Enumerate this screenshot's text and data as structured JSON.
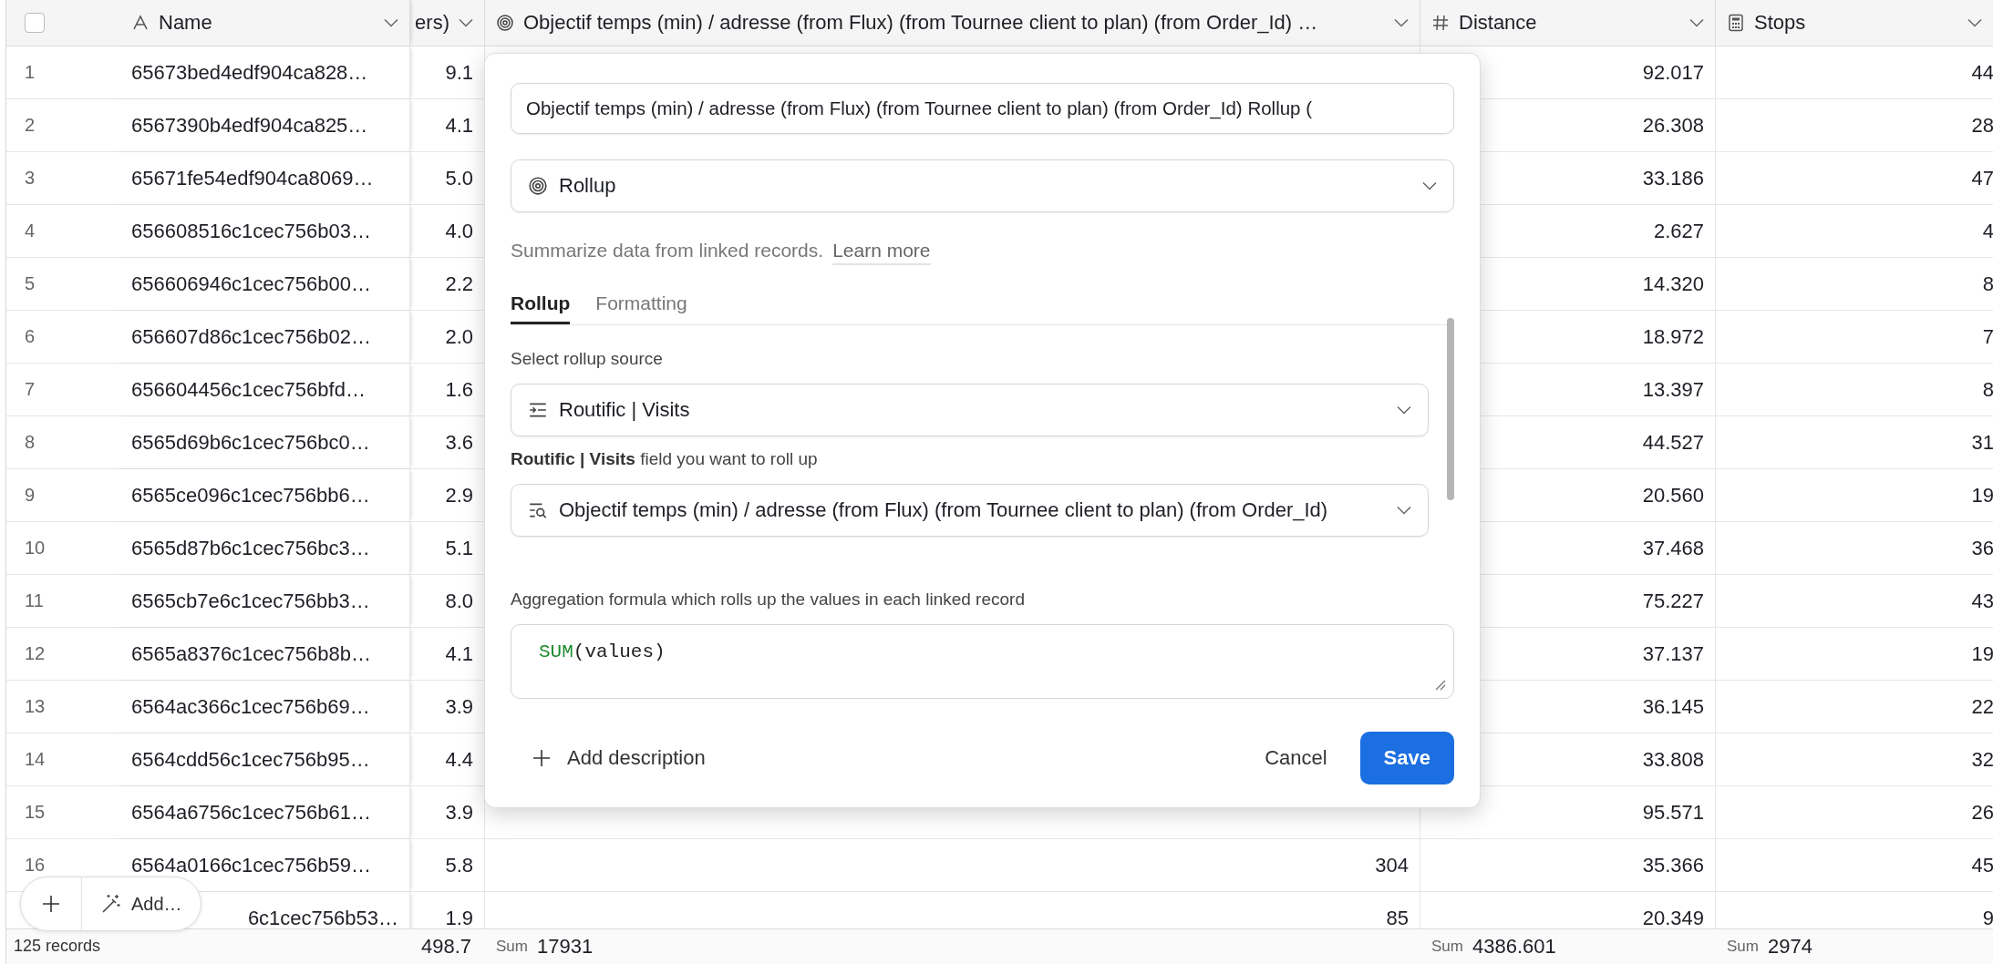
{
  "table": {
    "select_all": {
      "checked": false
    },
    "columns": [
      {
        "label": "Name",
        "kind": "text"
      },
      {
        "label": "ers)",
        "kind": "unknown"
      },
      {
        "label": "Objectif temps (min) / adresse (from Flux) (from Tournee client to plan) (from Order_Id) …",
        "kind": "rollup"
      },
      {
        "label": "Distance",
        "kind": "number"
      },
      {
        "label": "Stops",
        "kind": "formula"
      }
    ],
    "rows": [
      {
        "number": "1",
        "name": "65673bed4edf904ca828…",
        "column_2": "9.1",
        "distance": "92.017",
        "stops": "44"
      },
      {
        "number": "2",
        "name": "6567390b4edf904ca825…",
        "column_2": "4.1",
        "distance": "26.308",
        "stops": "28"
      },
      {
        "number": "3",
        "name": "65671fe54edf904ca8069…",
        "column_2": "5.0",
        "distance": "33.186",
        "stops": "47"
      },
      {
        "number": "4",
        "name": "656608516c1cec756b03…",
        "column_2": "4.0",
        "distance": "2.627",
        "stops": "4"
      },
      {
        "number": "5",
        "name": "656606946c1cec756b00…",
        "column_2": "2.2",
        "distance": "14.320",
        "stops": "8"
      },
      {
        "number": "6",
        "name": "656607d86c1cec756b02…",
        "column_2": "2.0",
        "distance": "18.972",
        "stops": "7"
      },
      {
        "number": "7",
        "name": "656604456c1cec756bfd…",
        "column_2": "1.6",
        "distance": "13.397",
        "stops": "8"
      },
      {
        "number": "8",
        "name": "6565d69b6c1cec756bc0…",
        "column_2": "3.6",
        "distance": "44.527",
        "stops": "31"
      },
      {
        "number": "9",
        "name": "6565ce096c1cec756bb6…",
        "column_2": "2.9",
        "distance": "20.560",
        "stops": "19"
      },
      {
        "number": "10",
        "name": "6565d87b6c1cec756bc3…",
        "column_2": "5.1",
        "distance": "37.468",
        "stops": "36"
      },
      {
        "number": "11",
        "name": "6565cb7e6c1cec756bb3…",
        "column_2": "8.0",
        "distance": "75.227",
        "stops": "43"
      },
      {
        "number": "12",
        "name": "6565a8376c1cec756b8b…",
        "column_2": "4.1",
        "distance": "37.137",
        "stops": "19"
      },
      {
        "number": "13",
        "name": "6564ac366c1cec756b69…",
        "column_2": "3.9",
        "distance": "36.145",
        "stops": "22"
      },
      {
        "number": "14",
        "name": "6564cdd56c1cec756b95…",
        "column_2": "4.4",
        "distance": "33.808",
        "stops": "32"
      },
      {
        "number": "15",
        "name": "6564a6756c1cec756b61…",
        "column_2": "3.9",
        "distance": "95.571",
        "stops": "26"
      },
      {
        "number": "16",
        "name": "6564a0166c1cec756b59…",
        "column_2": "5.8",
        "objective": "304",
        "distance": "35.366",
        "stops": "45"
      },
      {
        "name": "6c1cec756b53…",
        "column_2": "1.9",
        "objective": "85",
        "distance": "20.349",
        "stops": "9"
      }
    ],
    "footer": {
      "records": "125 records",
      "summaries": [
        {
          "value": "498.7"
        },
        {
          "prefix": "Sum",
          "value": "17931"
        },
        {
          "prefix": "Sum",
          "value": "4386.601"
        },
        {
          "prefix": "Sum",
          "value": "2974"
        }
      ]
    }
  },
  "add_bar": {
    "label": "Add…"
  },
  "dialog": {
    "field_name": "Objectif temps (min) / adresse (from Flux) (from Tournee client to plan) (from Order_Id) Rollup (",
    "field_type": {
      "label": "Rollup",
      "kind": "rollup"
    },
    "description": "Summarize data from linked records.",
    "learn_more": "Learn more",
    "tabs": [
      {
        "label": "Rollup",
        "selected": true
      },
      {
        "label": "Formatting",
        "selected": false
      }
    ],
    "source_label": "Select rollup source",
    "source": {
      "label": "Routific | Visits",
      "kind": "link"
    },
    "field_label": "**Routific | Visits** field you want to roll up",
    "field": {
      "label": "Objectif temps (min) / adresse (from Flux) (from Tournee client to plan) (from Order_Id)",
      "kind": "lookup"
    },
    "formula_label": "Aggregation formula which rolls up the values in each linked record",
    "formula": {
      "function": "SUM",
      "args": "(values)"
    },
    "add_description": "Add description",
    "cancel": "Cancel",
    "save": "Save"
  }
}
